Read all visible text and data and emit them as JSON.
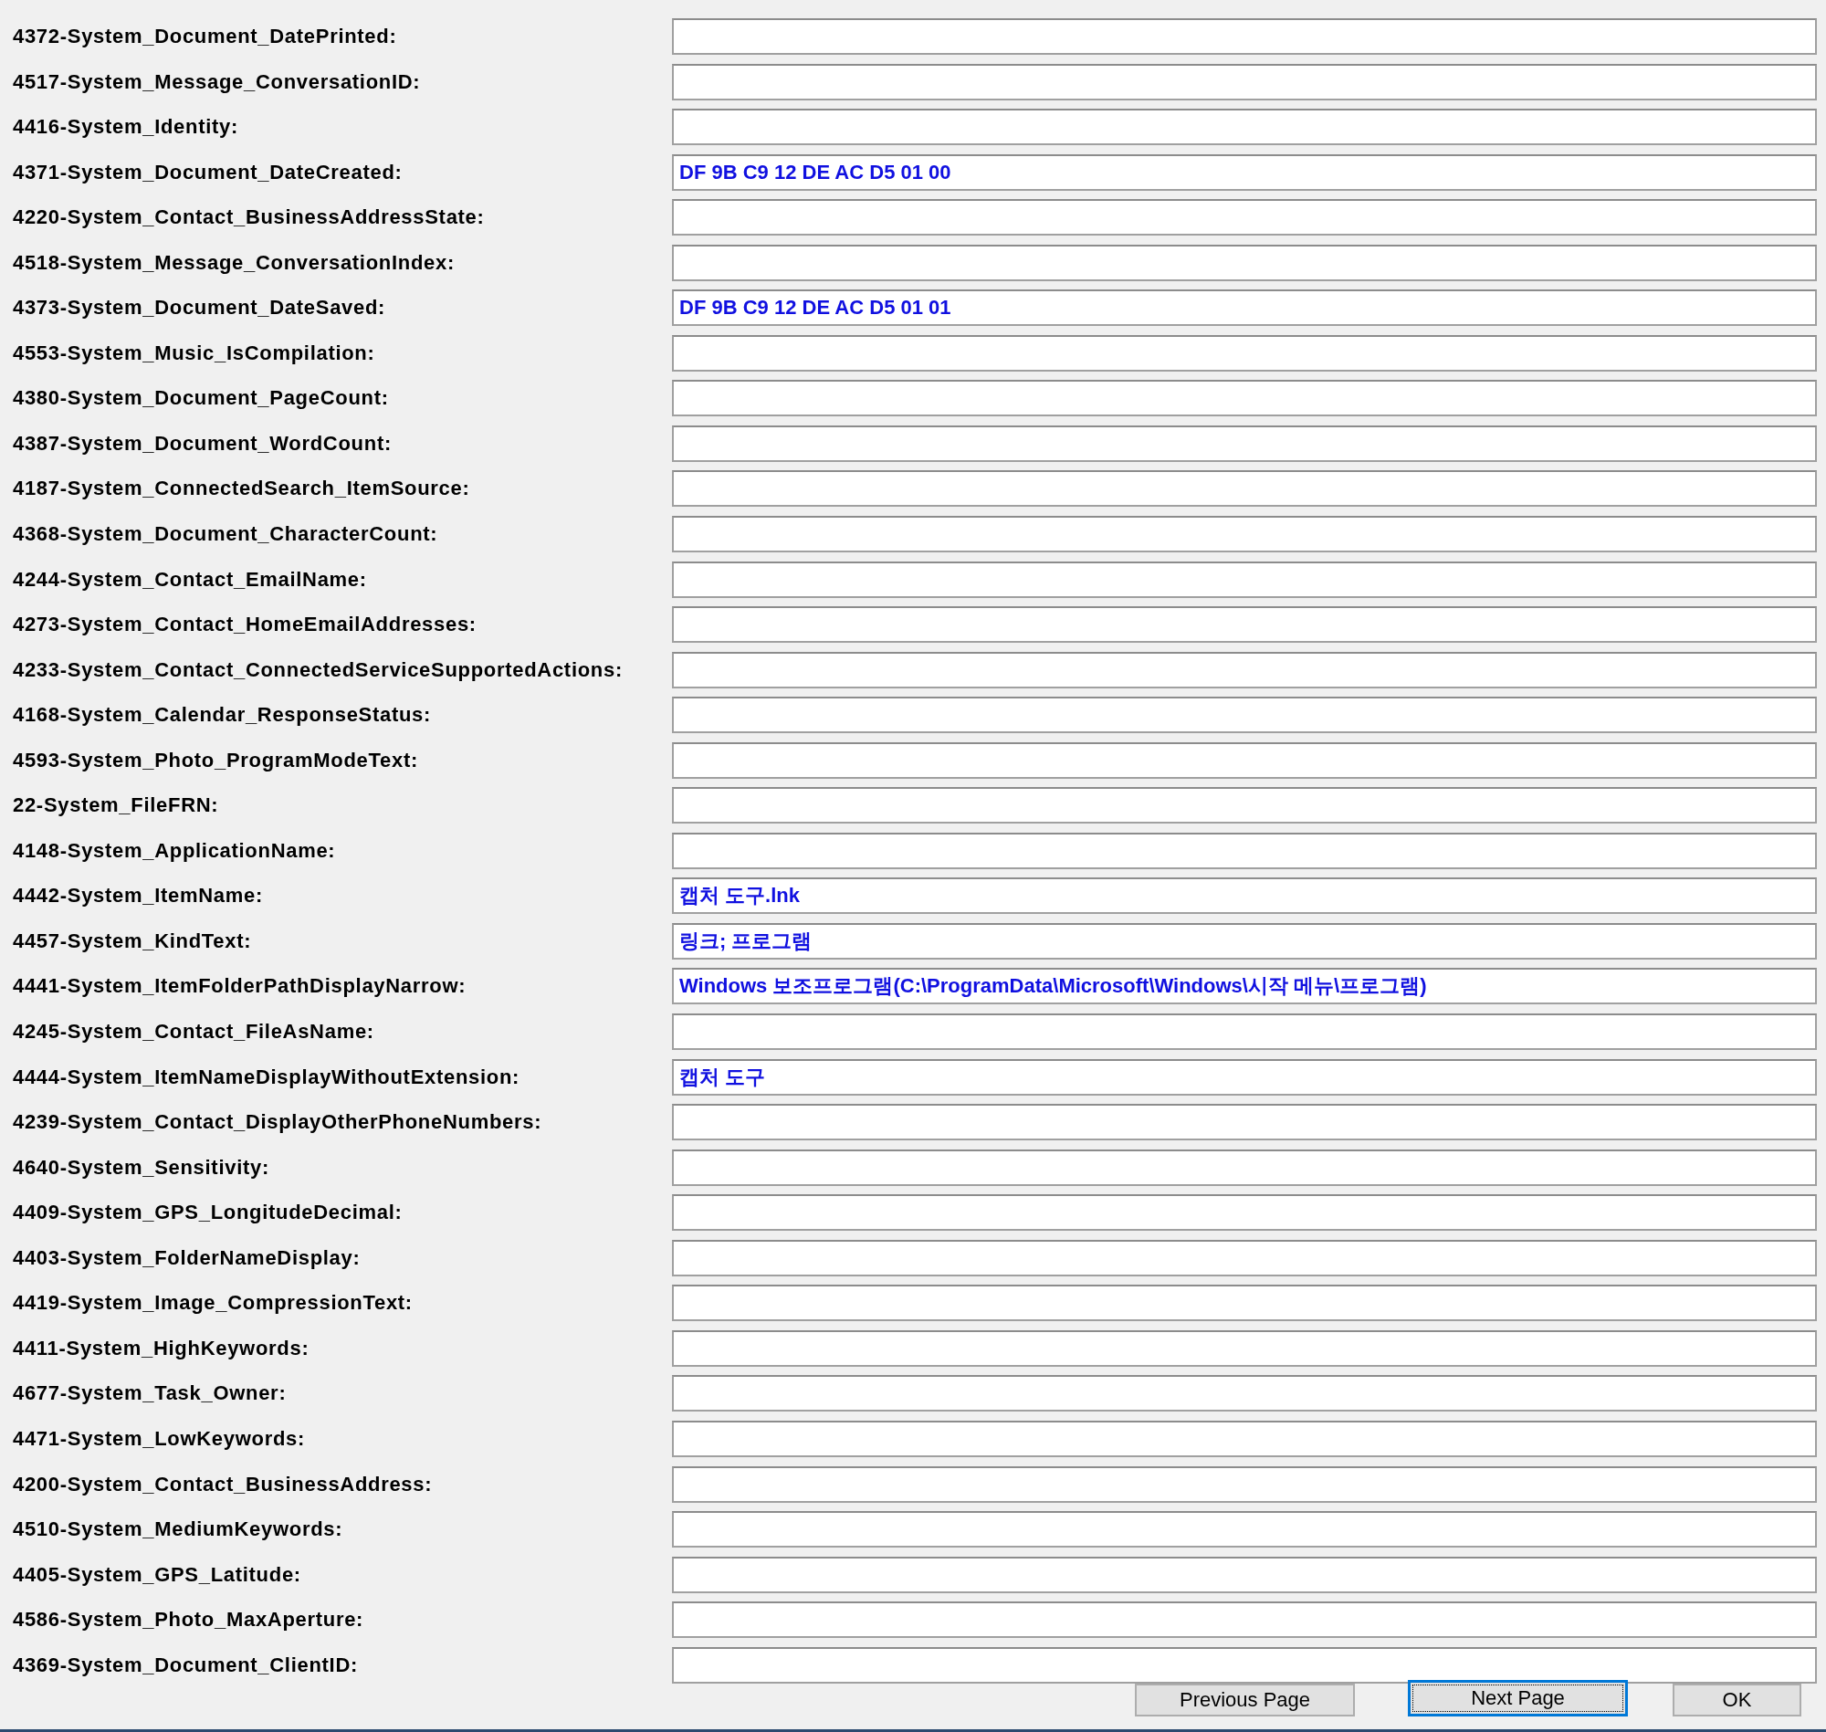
{
  "fields": [
    {
      "label": "4372-System_Document_DatePrinted:"
    },
    {
      "label": "4517-System_Message_ConversationID:"
    },
    {
      "label": "4416-System_Identity:"
    },
    {
      "label": "4371-System_Document_DateCreated:",
      "value": "DF 9B C9 12 DE AC D5 01 00"
    },
    {
      "label": "4220-System_Contact_BusinessAddressState:"
    },
    {
      "label": "4518-System_Message_ConversationIndex:"
    },
    {
      "label": "4373-System_Document_DateSaved:",
      "value": "DF 9B C9 12 DE AC D5 01 01"
    },
    {
      "label": "4553-System_Music_IsCompilation:"
    },
    {
      "label": "4380-System_Document_PageCount:"
    },
    {
      "label": "4387-System_Document_WordCount:"
    },
    {
      "label": "4187-System_ConnectedSearch_ItemSource:"
    },
    {
      "label": "4368-System_Document_CharacterCount:"
    },
    {
      "label": "4244-System_Contact_EmailName:"
    },
    {
      "label": "4273-System_Contact_HomeEmailAddresses:"
    },
    {
      "label": "4233-System_Contact_ConnectedServiceSupportedActions:"
    },
    {
      "label": "4168-System_Calendar_ResponseStatus:"
    },
    {
      "label": "4593-System_Photo_ProgramModeText:"
    },
    {
      "label": "22-System_FileFRN:"
    },
    {
      "label": "4148-System_ApplicationName:"
    },
    {
      "label": "4442-System_ItemName:",
      "value": "캡처 도구.lnk"
    },
    {
      "label": "4457-System_KindText:",
      "value": "링크; 프로그램"
    },
    {
      "label": "4441-System_ItemFolderPathDisplayNarrow:",
      "value": "Windows 보조프로그램(C:\\ProgramData\\Microsoft\\Windows\\시작 메뉴\\프로그램)"
    },
    {
      "label": "4245-System_Contact_FileAsName:"
    },
    {
      "label": "4444-System_ItemNameDisplayWithoutExtension:",
      "value": "캡처 도구"
    },
    {
      "label": "4239-System_Contact_DisplayOtherPhoneNumbers:"
    },
    {
      "label": "4640-System_Sensitivity:"
    },
    {
      "label": "4409-System_GPS_LongitudeDecimal:"
    },
    {
      "label": "4403-System_FolderNameDisplay:"
    },
    {
      "label": "4419-System_Image_CompressionText:"
    },
    {
      "label": "4411-System_HighKeywords:"
    },
    {
      "label": "4677-System_Task_Owner:"
    },
    {
      "label": "4471-System_LowKeywords:"
    },
    {
      "label": "4200-System_Contact_BusinessAddress:"
    },
    {
      "label": "4510-System_MediumKeywords:"
    },
    {
      "label": "4405-System_GPS_Latitude:"
    },
    {
      "label": "4586-System_Photo_MaxAperture:"
    },
    {
      "label": "4369-System_Document_ClientID:"
    }
  ],
  "buttons": [
    {
      "label": "Previous Page",
      "focused": false
    },
    {
      "label": "Next Page",
      "focused": true
    },
    {
      "label": "OK",
      "focused": false
    }
  ]
}
